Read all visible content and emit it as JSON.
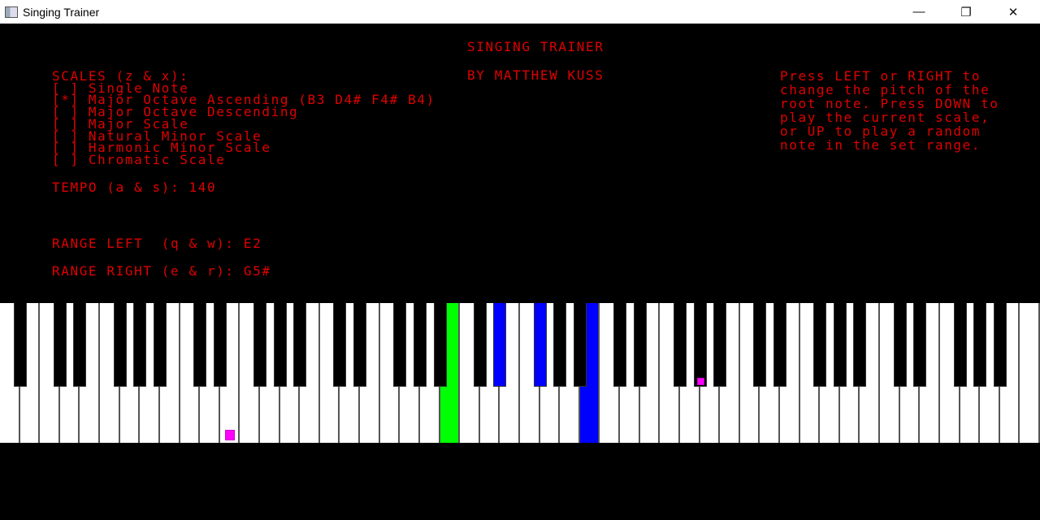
{
  "window": {
    "title": "Singing Trainer",
    "minimize": "—",
    "maximize": "❐",
    "close": "✕"
  },
  "header": {
    "title": "SINGING TRAINER",
    "author": "BY MATTHEW KUSS"
  },
  "scales": {
    "heading": "SCALES (z & x):",
    "items": [
      "[ ] Single Note",
      "[*] Major Octave Ascending (B3 D4# F4# B4)",
      "[ ] Major Octave Descending",
      "[ ] Major Scale",
      "[ ] Natural Minor Scale",
      "[ ] Harmonic Minor Scale",
      "[ ] Chromatic Scale"
    ],
    "selected_index": 1
  },
  "tempo": "TEMPO (a & s): 140",
  "range_left": "RANGE LEFT  (q & w): E2",
  "range_right": "RANGE RIGHT (e & r): G5#",
  "help": [
    "Press LEFT or RIGHT to",
    "change the pitch of the",
    "root note. Press DOWN to",
    "play the current scale,",
    "or UP to play a random",
    "note in the set range."
  ],
  "keyboard": {
    "lowest": "A0",
    "white_key_count": 52,
    "root_note": "B3",
    "root_color": "#00ff00",
    "scale_notes": [
      "D#4",
      "F#4",
      "B4"
    ],
    "scale_color": "#0000ff",
    "range_markers": [
      "E2",
      "G#5"
    ],
    "marker_color": "#ff00ff"
  },
  "colors": {
    "text": "#e00000",
    "background": "#000000"
  }
}
